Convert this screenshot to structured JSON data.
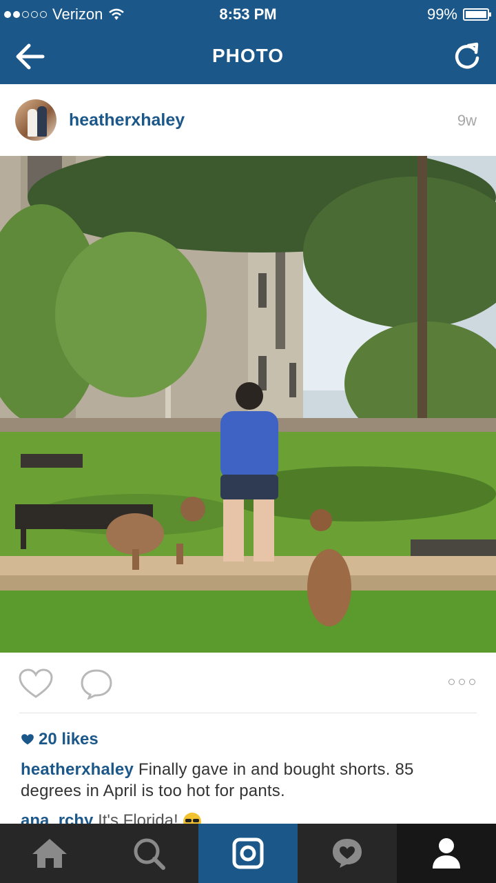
{
  "status_bar": {
    "carrier": "Verizon",
    "time": "8:53 PM",
    "battery": "99%",
    "signal_icon": "signal-dots-icon",
    "wifi_icon": "wifi-icon"
  },
  "nav": {
    "title": "PHOTO",
    "back_icon": "back-arrow-icon",
    "refresh_icon": "refresh-icon"
  },
  "post": {
    "username": "heatherxhaley",
    "age": "9w",
    "likes": "20 likes",
    "caption_user": "heatherxhaley",
    "caption_text": "Finally gave in and bought shorts. 85 degrees in April is too hot for pants.",
    "comment_user": "ana_rchy",
    "comment_text": "It's Florida!"
  },
  "tabbar": {
    "items": [
      {
        "icon": "home-icon"
      },
      {
        "icon": "search-icon"
      },
      {
        "icon": "camera-icon"
      },
      {
        "icon": "activity-icon"
      },
      {
        "icon": "profile-icon"
      }
    ]
  },
  "colors": {
    "brand": "#1b5788",
    "tabbar": "#272727"
  }
}
